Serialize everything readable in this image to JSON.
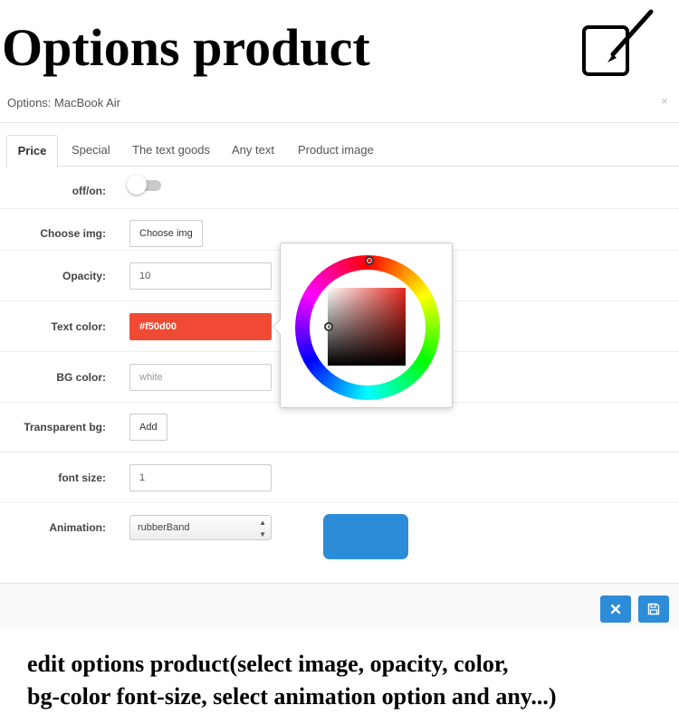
{
  "promo": {
    "title": "Options product",
    "caption_line1": "edit options product(select image, opacity, color,",
    "caption_line2": "bg-color font-size, select animation option and any...)"
  },
  "modal": {
    "title": "Options: MacBook Air",
    "close_label": "×"
  },
  "tabs": [
    {
      "label": "Price",
      "active": true
    },
    {
      "label": "Special",
      "active": false
    },
    {
      "label": "The text goods",
      "active": false
    },
    {
      "label": "Any text",
      "active": false
    },
    {
      "label": "Product image",
      "active": false
    }
  ],
  "form": {
    "toggle": {
      "label": "off/on:",
      "state": "off"
    },
    "choose_img": {
      "label": "Choose img:",
      "button_label": "Choose img"
    },
    "opacity": {
      "label": "Opacity:",
      "value": "10"
    },
    "text_color": {
      "label": "Text color:",
      "value": "#f50d00",
      "swatch": "#f04a35"
    },
    "bg_color": {
      "label": "BG color:",
      "placeholder": "white"
    },
    "transparent_bg": {
      "label": "Transparent bg:",
      "button_label": "Add"
    },
    "font_size": {
      "label": "font size:",
      "value": "1"
    },
    "animation": {
      "label": "Animation:",
      "selected": "rubberBand",
      "preview_color": "#2d8cd8"
    }
  },
  "footer": {
    "cancel_icon": "close-icon",
    "save_icon": "save-icon",
    "button_color": "#2d8cd8"
  },
  "color_picker": {
    "selected_color": "#f50d00"
  }
}
